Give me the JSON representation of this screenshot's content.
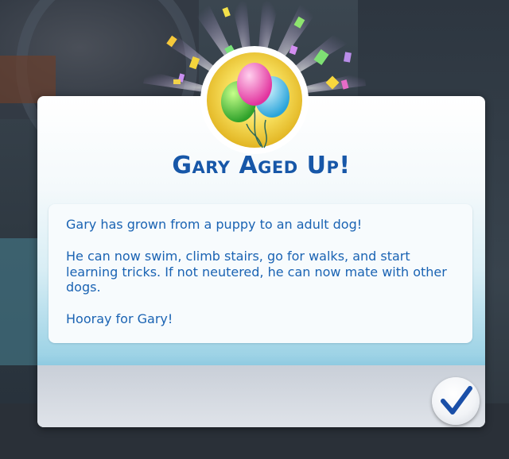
{
  "dialog": {
    "title": "Gary Aged Up!",
    "paragraphs": [
      "Gary has grown from a puppy to an adult dog!",
      "He can now swim, climb stairs, go for walks, and start learning tricks. If not neutered, he can now mate with other dogs.",
      "Hooray for Gary!"
    ],
    "emblem_icon": "balloons-icon",
    "confirm_icon": "checkmark-icon"
  },
  "colors": {
    "title": "#1757a8",
    "body_text": "#1a63b3",
    "check": "#1a4fa8"
  }
}
